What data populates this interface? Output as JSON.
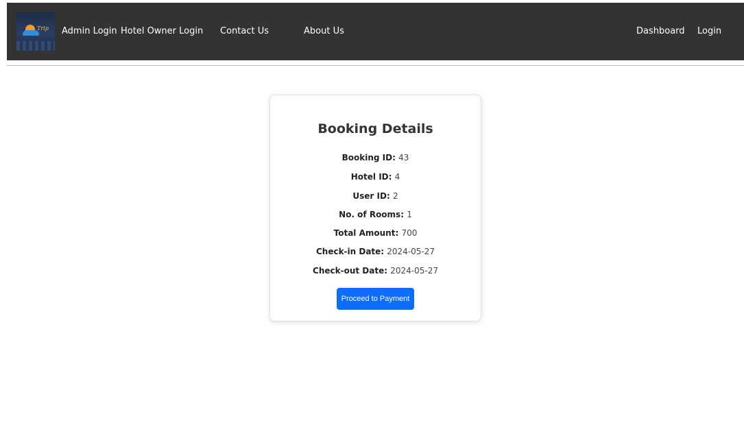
{
  "navbar": {
    "logo_text": "Trip",
    "links_left": [
      "Admin Login",
      "Hotel Owner Login",
      "Contact Us",
      "About Us"
    ],
    "links_right": [
      "Dashboard",
      "Login"
    ]
  },
  "booking": {
    "title": "Booking Details",
    "fields": [
      {
        "label": "Booking ID:",
        "value": "43"
      },
      {
        "label": "Hotel ID:",
        "value": "4"
      },
      {
        "label": "User ID:",
        "value": "2"
      },
      {
        "label": "No. of Rooms:",
        "value": "1"
      },
      {
        "label": "Total Amount:",
        "value": "700"
      },
      {
        "label": "Check-in Date:",
        "value": "2024-05-27"
      },
      {
        "label": "Check-out Date:",
        "value": "2024-05-27"
      }
    ],
    "button_label": "Proceed to Payment"
  },
  "colors": {
    "navbar_bg": "#333333",
    "button_bg": "#0d6efd"
  }
}
